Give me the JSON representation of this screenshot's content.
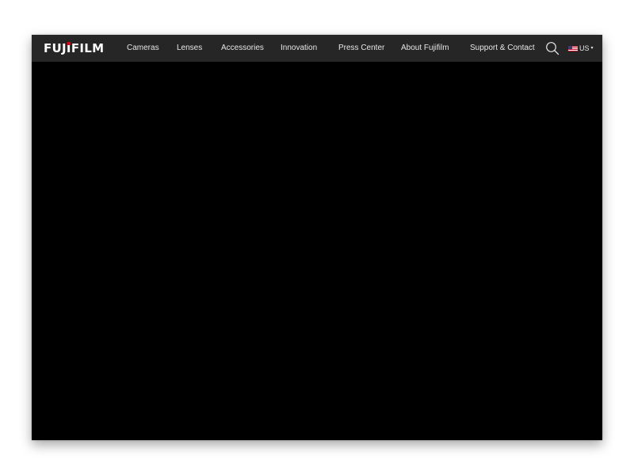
{
  "brand": {
    "name_before_i": "FUJ",
    "name_i": "I",
    "name_after_i": "FILM",
    "accent_color": "#e60012"
  },
  "nav": {
    "items": [
      {
        "label": "Cameras"
      },
      {
        "label": "Lenses"
      },
      {
        "label": "Accessories"
      },
      {
        "label": "Innovation"
      },
      {
        "label": "Press Center"
      },
      {
        "label": "About Fujifilm"
      },
      {
        "label": "Support & Contact"
      }
    ]
  },
  "search": {
    "icon": "search-icon"
  },
  "locale": {
    "flag": "us-flag-icon",
    "label": "US",
    "caret": "▾"
  },
  "colors": {
    "navbar_bg": "#262626",
    "page_bg": "#000000",
    "nav_text": "#e6e6e6"
  }
}
